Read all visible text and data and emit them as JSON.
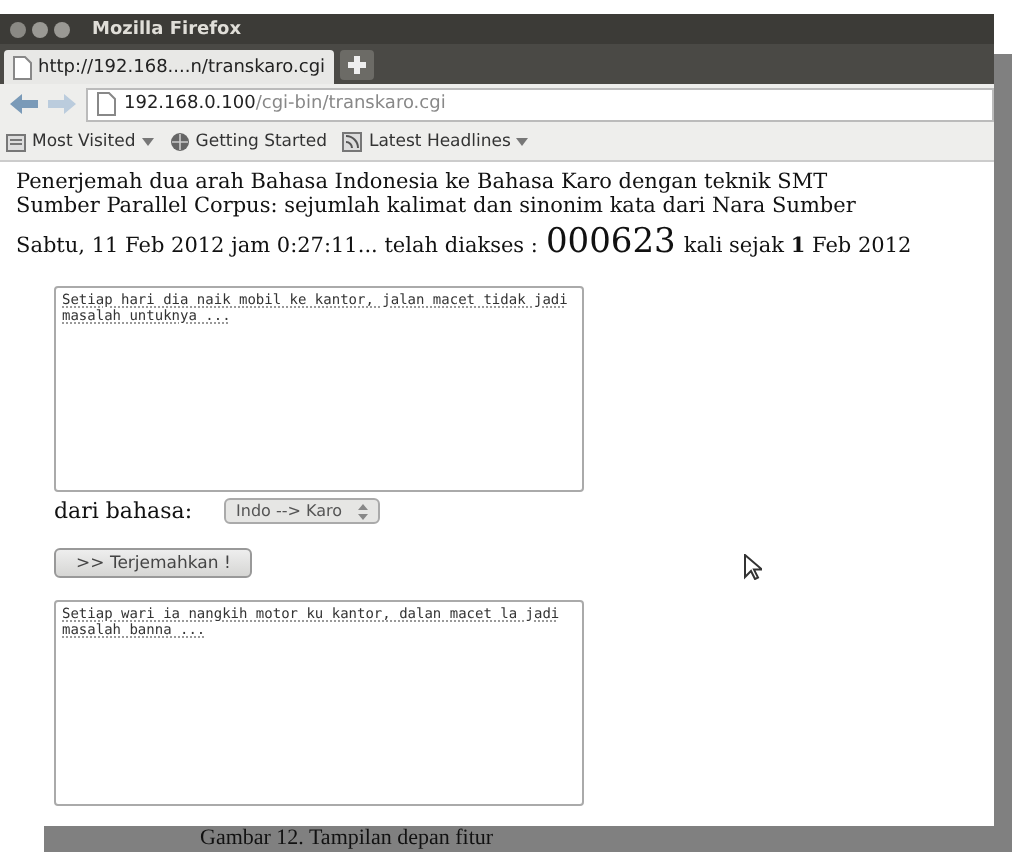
{
  "window": {
    "title": "Mozilla Firefox"
  },
  "tabs": [
    {
      "label": "http://192.168....n/transkaro.cgi",
      "selected": true
    }
  ],
  "nav_buttons": [
    {
      "kind": "back",
      "disabled": false
    },
    {
      "kind": "forward",
      "disabled": true
    }
  ],
  "address_bar": {
    "host": "192.168.0.100",
    "path": "/cgi-bin/transkaro.cgi"
  },
  "bookmarks": [
    {
      "label": "Most Visited",
      "kind": "folder",
      "dropdown": true
    },
    {
      "label": "Getting Started",
      "kind": "globe",
      "dropdown": false
    },
    {
      "label": "Latest Headlines",
      "kind": "feed",
      "dropdown": true
    }
  ],
  "page": {
    "heading_lines": [
      "Penerjemah dua arah Bahasa Indonesia ke Bahasa Karo dengan teknik SMT",
      "Sumber Parallel Corpus: sejumlah kalimat dan sinonim kata dari Nara Sumber"
    ],
    "visit_prefix": "Sabtu, 11 Feb 2012 jam 0:27:11... telah diakses :",
    "counter": "000623",
    "visit_suffix": "kali sejak **1** Feb 2012",
    "input_text": "Setiap hari dia naik mobil ke kantor, jalan macet tidak jadi masalah untuknya ...",
    "language_label": "dari bahasa:",
    "language_select": "Indo --> Karo",
    "translate_button": ">> Terjemahkan !",
    "output_text": "Setiap wari ia nangkih motor ku kantor, dalan macet la jadi masalah banna ..."
  },
  "caption": "Gambar 12. Tampilan depan fitur"
}
